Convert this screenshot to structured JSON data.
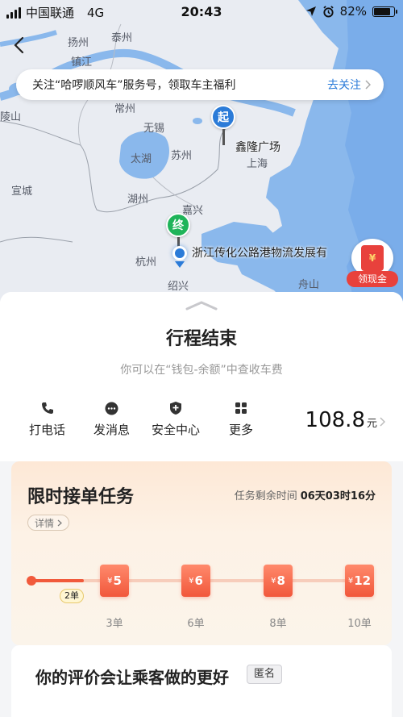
{
  "status_bar": {
    "carrier": "中国联通",
    "network": "4G",
    "time": "20:43",
    "battery": "82%",
    "battery_level": 0.82
  },
  "map": {
    "cities": [
      "扬州",
      "泰州",
      "镇江",
      "常州",
      "陵山",
      "无锡",
      "太湖",
      "苏州",
      "上海",
      "宣城",
      "湖州",
      "嘉兴",
      "杭州",
      "舟山",
      "绍兴"
    ],
    "start_marker": "起",
    "start_name": "鑫隆广场",
    "end_marker": "终",
    "end_name": "浙江传化公路港物流发展有",
    "banner": {
      "text": "关注“哈啰顺风车”服务号，领取车主福利",
      "link": "去关注"
    },
    "red_packet": {
      "symbol": "¥",
      "label": "领现金"
    }
  },
  "trip": {
    "title": "行程结束",
    "subtitle": "你可以在“钱包-余额”中查收车费",
    "actions": [
      {
        "label": "打电话",
        "icon": "phone-icon"
      },
      {
        "label": "发消息",
        "icon": "message-icon"
      },
      {
        "label": "安全中心",
        "icon": "shield-icon"
      },
      {
        "label": "更多",
        "icon": "grid-icon"
      }
    ],
    "fare_amount": "108.8",
    "fare_unit": "元"
  },
  "task": {
    "title": "限时接单任务",
    "remaining_label": "任务剩余时间",
    "remaining_value": "06天03时16分",
    "detail_label": "详情",
    "current_badge": "2单",
    "current_orders": 2,
    "max_orders": 10,
    "currency": "¥",
    "rewards": [
      {
        "amount": "5",
        "orders": "3单"
      },
      {
        "amount": "6",
        "orders": "6单"
      },
      {
        "amount": "8",
        "orders": "8单"
      },
      {
        "amount": "12",
        "orders": "10单"
      }
    ]
  },
  "review": {
    "title": "你的评价会让乘客做的更好",
    "anonymous_tag": "匿名"
  },
  "colors": {
    "accent_blue": "#2b7bd8",
    "end_green": "#1fb45a",
    "reward_red": "#f1573b",
    "sea": "#8ab8ec"
  }
}
